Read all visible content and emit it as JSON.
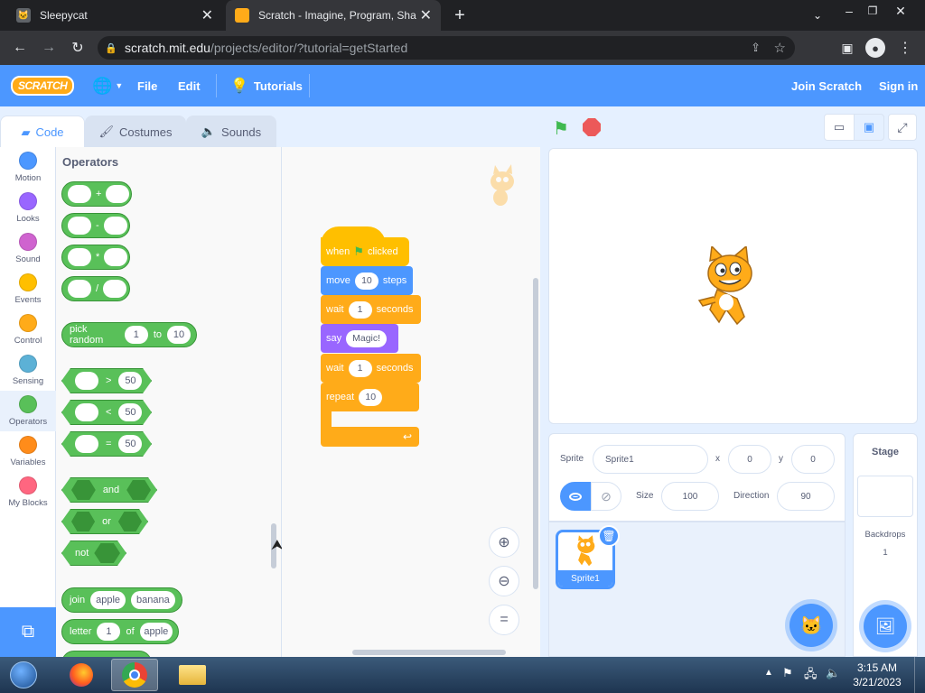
{
  "browser": {
    "tabs": [
      {
        "title": "Sleepycat",
        "active": false
      },
      {
        "title": "Scratch - Imagine, Program, Shar",
        "active": true
      }
    ],
    "url_host": "scratch.mit.edu",
    "url_path": "/projects/editor/?tutorial=getStarted"
  },
  "menubar": {
    "logo": "SCRATCH",
    "items": [
      "File",
      "Edit"
    ],
    "tutorials": "Tutorials",
    "join": "Join Scratch",
    "signin": "Sign in"
  },
  "editor_tabs": [
    "Code",
    "Costumes",
    "Sounds"
  ],
  "categories": [
    {
      "label": "Motion",
      "color": "#4c97ff"
    },
    {
      "label": "Looks",
      "color": "#9966ff"
    },
    {
      "label": "Sound",
      "color": "#cf63cf"
    },
    {
      "label": "Events",
      "color": "#ffbf00"
    },
    {
      "label": "Control",
      "color": "#ffab19"
    },
    {
      "label": "Sensing",
      "color": "#5cb1d6"
    },
    {
      "label": "Operators",
      "color": "#59c059"
    },
    {
      "label": "Variables",
      "color": "#ff8c1a"
    },
    {
      "label": "My Blocks",
      "color": "#ff6680"
    }
  ],
  "palette": {
    "title": "Operators",
    "arith": [
      "+",
      "-",
      "*",
      "/"
    ],
    "random": {
      "label": "pick random",
      "from": "1",
      "to_label": "to",
      "to": "10"
    },
    "compare": [
      {
        "op": ">",
        "value": "50"
      },
      {
        "op": "<",
        "value": "50"
      },
      {
        "op": "=",
        "value": "50"
      }
    ],
    "bool": [
      "and",
      "or",
      "not"
    ],
    "join": {
      "label": "join",
      "a": "apple",
      "b": "banana"
    },
    "letter": {
      "label": "letter",
      "n": "1",
      "of": "of",
      "s": "apple"
    }
  },
  "script": {
    "hat": {
      "pre": "when",
      "post": "clicked"
    },
    "move": {
      "label": "move",
      "value": "10",
      "unit": "steps"
    },
    "wait1": {
      "label": "wait",
      "value": "1",
      "unit": "seconds"
    },
    "say": {
      "label": "say",
      "value": "Magic!"
    },
    "wait2": {
      "label": "wait",
      "value": "1",
      "unit": "seconds"
    },
    "repeat": {
      "label": "repeat",
      "value": "10"
    }
  },
  "sprite_info": {
    "sprite_label": "Sprite",
    "name": "Sprite1",
    "x_label": "x",
    "x": "0",
    "y_label": "y",
    "y": "0",
    "size_label": "Size",
    "size": "100",
    "direction_label": "Direction",
    "direction": "90"
  },
  "sprites": [
    {
      "name": "Sprite1"
    }
  ],
  "stage_panel": {
    "title": "Stage",
    "backdrops_label": "Backdrops",
    "backdrops_count": "1"
  },
  "taskbar": {
    "time": "3:15 AM",
    "date": "3/21/2023"
  },
  "colors": {
    "menubar": "#4c97ff",
    "operators": "#59c059",
    "events": "#ffbf00",
    "control": "#ffab19",
    "motion": "#4c97ff",
    "looks": "#9966ff"
  }
}
